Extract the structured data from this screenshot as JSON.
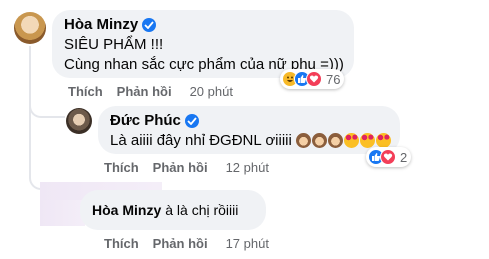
{
  "comments": [
    {
      "author": "Hòa Minzy",
      "lines": [
        "SIÊU PHẨM !!!",
        "Cùng nhan sắc cực phẩm của nữ phụ =)))"
      ],
      "actions": {
        "like": "Thích",
        "reply": "Phản hồi",
        "time": "20 phút"
      },
      "reactions": {
        "count": "76",
        "icons": [
          "haha",
          "like",
          "love"
        ]
      }
    },
    {
      "author": "Đức Phúc",
      "text": "Là aiiii đây nhỉ ĐGĐNL ơiiiii",
      "emojis": [
        "see-no-evil",
        "see-no-evil",
        "see-no-evil",
        "smiling-hearts",
        "smiling-hearts",
        "smiling-hearts"
      ],
      "actions": {
        "like": "Thích",
        "reply": "Phản hồi",
        "time": "12 phút"
      },
      "reactions": {
        "count": "2",
        "icons": [
          "like",
          "love"
        ]
      }
    },
    {
      "author": "Hòa Minzy",
      "text": "à là chị rồiiii",
      "actions": {
        "like": "Thích",
        "reply": "Phản hồi",
        "time": "17 phút"
      }
    }
  ],
  "colors": {
    "bubble": "#f0f2f5",
    "verified": "#1877f2",
    "meta_text": "#65676b",
    "like_blue": "#1877f2",
    "love_red": "#f33e58",
    "haha_yellow": "#f7b928"
  }
}
